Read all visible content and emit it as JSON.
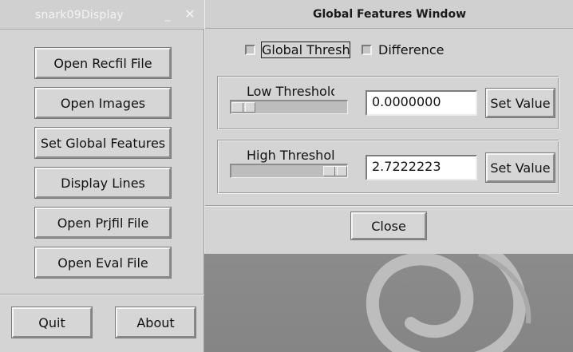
{
  "left_window": {
    "title": "snark09Display",
    "minimize_glyph": "_",
    "close_glyph": "✕",
    "buttons": [
      {
        "label": "Open Recfil File"
      },
      {
        "label": "Open Images"
      },
      {
        "label": "Set Global Features"
      },
      {
        "label": "Display Lines"
      },
      {
        "label": "Open Prjfil File"
      },
      {
        "label": "Open Eval File"
      }
    ],
    "quit_label": "Quit",
    "about_label": "About"
  },
  "right_window": {
    "title": "Global Features Window",
    "checkboxes": [
      {
        "label": "Global Thresh",
        "checked": false,
        "focused": true
      },
      {
        "label": "Difference",
        "checked": false,
        "focused": false
      }
    ],
    "low": {
      "label": "Low Threshold",
      "value": "0.0000000",
      "slider_fraction": 0.0,
      "button_label": "Set Value"
    },
    "high": {
      "label": "High Threshold",
      "value": "2.7222223",
      "slider_fraction": 1.0,
      "button_label": "Set Value"
    },
    "close_label": "Close"
  },
  "colors": {
    "window_bg": "#d4d4d4",
    "desktop_bg": "#8f8f8f",
    "title_text_inactive": "#f4f4f4"
  },
  "icons": [
    "minimize-icon",
    "close-icon",
    "debian-swirl-icon"
  ]
}
